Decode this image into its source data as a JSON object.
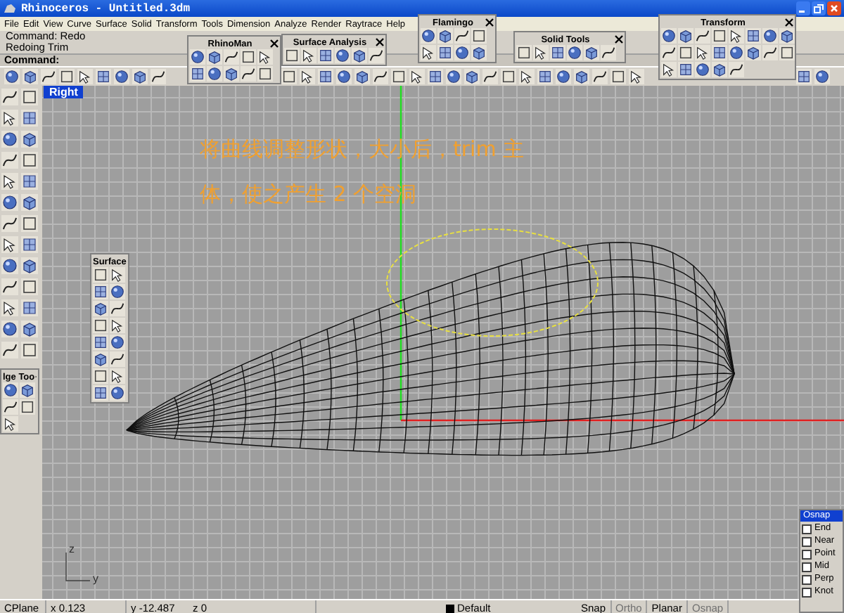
{
  "window": {
    "title": "Rhinoceros - Untitled.3dm"
  },
  "menu": [
    "File",
    "Edit",
    "View",
    "Curve",
    "Surface",
    "Solid",
    "Transform",
    "Tools",
    "Dimension",
    "Analyze",
    "Render",
    "Raytrace",
    "Help"
  ],
  "command_history": [
    "Command: Redo",
    "Redoing Trim"
  ],
  "command_prompt": "Command:",
  "viewport": {
    "title": "Right",
    "annotation_lines": [
      "将曲线调整形状，大小后，trim 主",
      "体，使之产生 2 个空洞"
    ],
    "axis_labels": [
      "z",
      "y"
    ]
  },
  "floating_toolbars": [
    {
      "title": "RhinoMan"
    },
    {
      "title": "Surface Analysis"
    },
    {
      "title": "Flamingo"
    },
    {
      "title": "Solid Tools"
    },
    {
      "title": "Transform"
    },
    {
      "title": "Surface"
    },
    {
      "title": "lge Too"
    }
  ],
  "osnap": {
    "title": "Osnap",
    "options": [
      {
        "label": "End",
        "checked": false
      },
      {
        "label": "Near",
        "checked": false
      },
      {
        "label": "Point",
        "checked": false
      },
      {
        "label": "Mid",
        "checked": false
      },
      {
        "label": "Perp",
        "checked": false
      },
      {
        "label": "Knot",
        "checked": false
      }
    ]
  },
  "status_bar": {
    "cplane": "CPlane",
    "x": "x 0.123",
    "y": "y -12.487",
    "z": "z 0",
    "layer": "Default",
    "toggles": [
      {
        "label": "Snap",
        "on": true
      },
      {
        "label": "Ortho",
        "on": false
      },
      {
        "label": "Planar",
        "on": true
      },
      {
        "label": "Osnap",
        "on": false
      }
    ]
  }
}
